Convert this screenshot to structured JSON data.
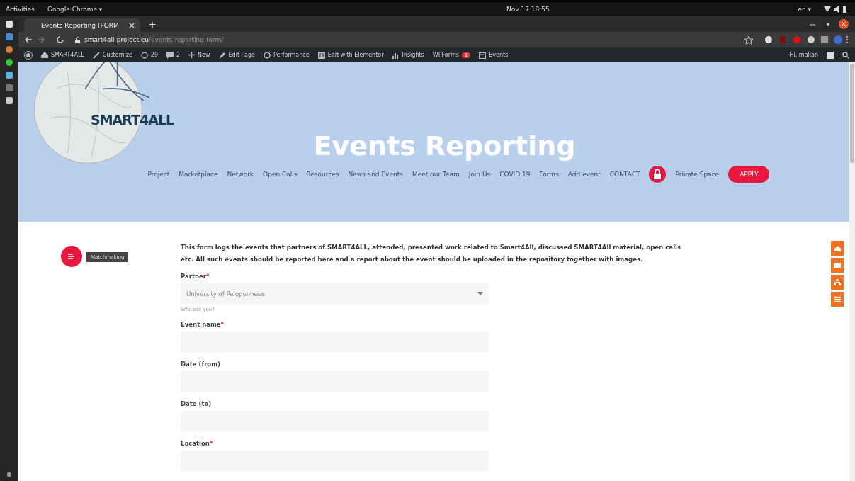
{
  "system_bar": {
    "activities": "Activities",
    "app_menu": "Google Chrome ▾",
    "clock": "Nov 17 18:55",
    "language": "en ▾"
  },
  "browser": {
    "tabs": [
      {
        "title": "Events Reporting (FORM",
        "selected": true
      }
    ],
    "new_tab": "+",
    "url_host": "smart4all-project.eu",
    "url_path": "/events-reporting-form/"
  },
  "admin_bar": {
    "items": [
      {
        "label": "SMART4ALL",
        "kind": "site"
      },
      {
        "label": "Customize",
        "kind": "brush"
      },
      {
        "label": "29",
        "kind": "updates"
      },
      {
        "label": "2",
        "kind": "comments"
      },
      {
        "label": "New",
        "kind": "plus"
      },
      {
        "label": "Edit Page",
        "kind": "pencil"
      },
      {
        "label": "Performance",
        "kind": "gauge"
      },
      {
        "label": "Edit with Elementor",
        "kind": "square"
      },
      {
        "label": "Insights",
        "kind": "bars"
      },
      {
        "label": "WPForms",
        "kind": "forms",
        "badge": "1"
      },
      {
        "label": "Events",
        "kind": "calendar"
      }
    ],
    "greeting": "Hi, makan"
  },
  "hero": {
    "logo_text": "SMART4ALL",
    "title": "Events Reporting",
    "nav": [
      {
        "label": "Project"
      },
      {
        "label": "Marketplace"
      },
      {
        "label": "Network"
      },
      {
        "label": "Open Calls"
      },
      {
        "label": "Resources"
      },
      {
        "label": "News and Events"
      },
      {
        "label": "Meet our Team"
      },
      {
        "label": "Join Us"
      },
      {
        "label": "COVID 19"
      },
      {
        "label": "Forms"
      },
      {
        "label": "Add event"
      },
      {
        "label": "CONTACT"
      }
    ],
    "private_space": "Private Space",
    "apply": "APPLY"
  },
  "side_tooltip": "Matchmaking",
  "intro": "This form logs the events that partners of SMART4ALL, attended, presented work related to Smart4All, discussed SMART4All material, open calls etc. All such events should be reported here and a report about the event should be uploaded in the repository together with images.",
  "form": {
    "required_mark": "*",
    "fields": [
      {
        "label": "Partner",
        "required": true,
        "kind": "select",
        "value": "University of Peloponnese",
        "help": "Who are you?"
      },
      {
        "label": "Event name",
        "required": true,
        "kind": "text"
      },
      {
        "label": "Date (from)",
        "required": false,
        "kind": "text"
      },
      {
        "label": "Date (to)",
        "required": false,
        "kind": "text"
      },
      {
        "label": "Location",
        "required": true,
        "kind": "text"
      }
    ]
  }
}
